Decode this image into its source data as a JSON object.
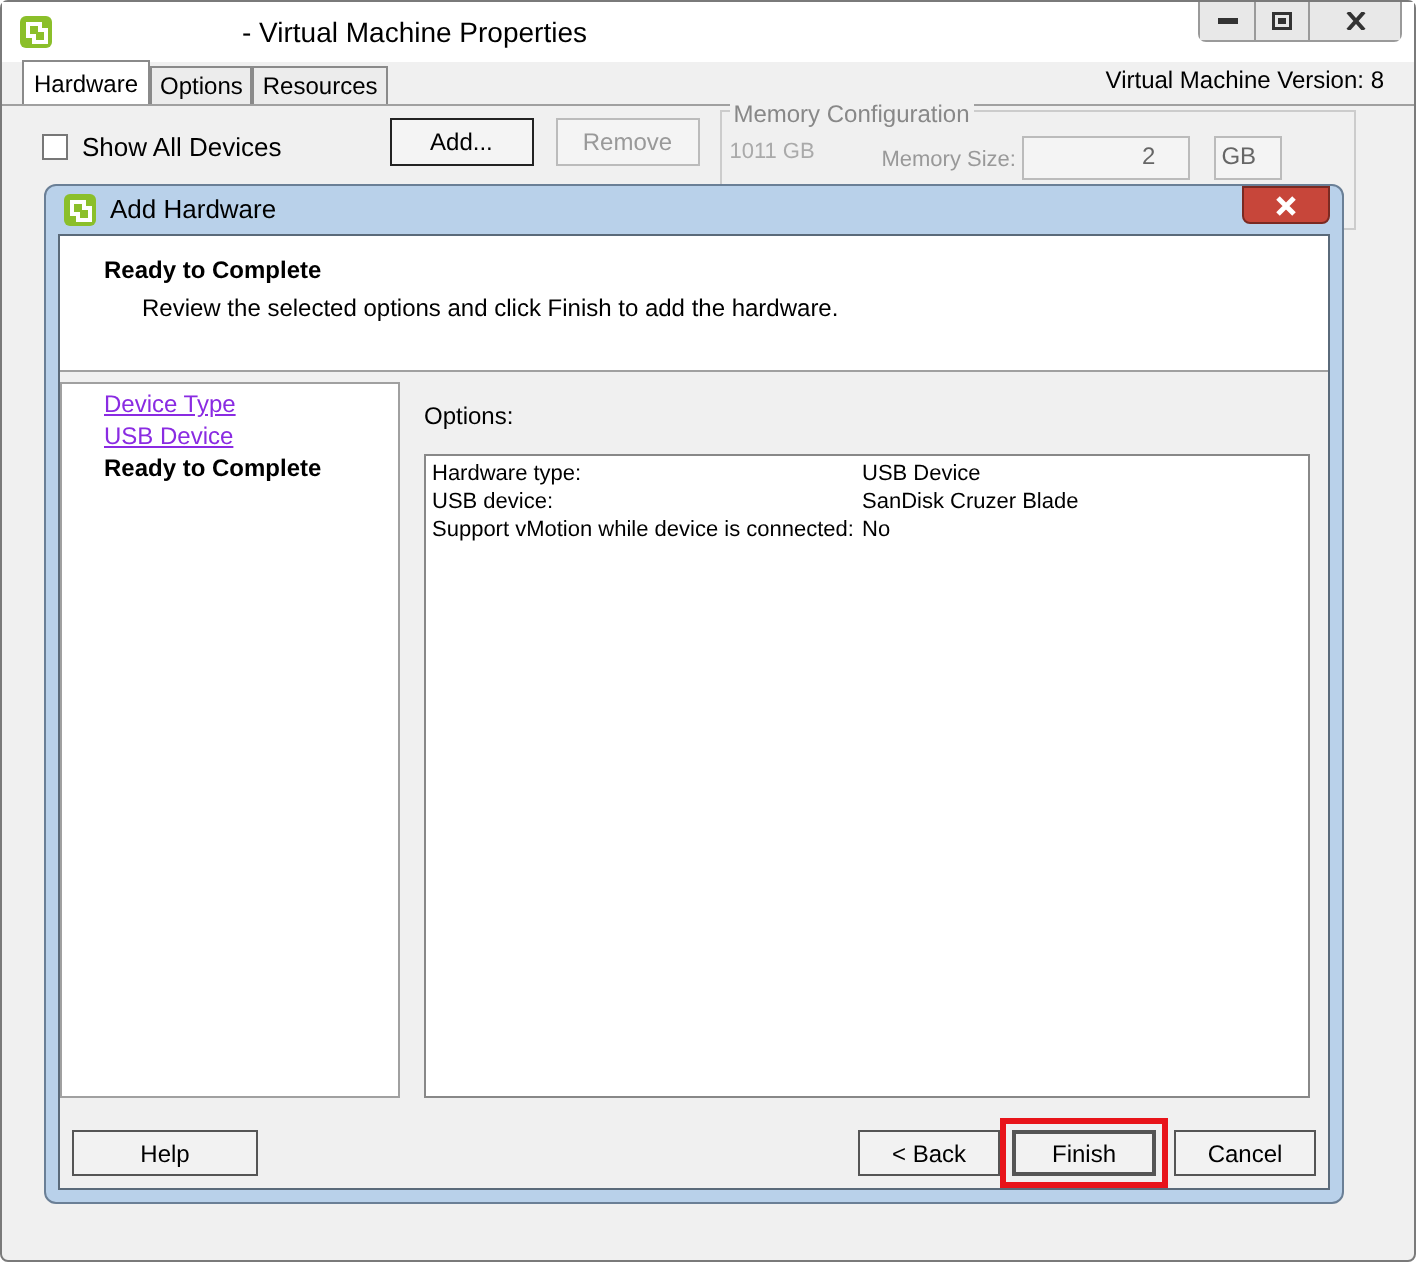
{
  "window": {
    "title": "- Virtual Machine Properties"
  },
  "tabs": [
    {
      "label": "Hardware",
      "selected": true
    },
    {
      "label": "Options",
      "selected": false
    },
    {
      "label": "Resources",
      "selected": false
    }
  ],
  "version": "Virtual Machine Version: 8",
  "show_all_devices": {
    "label": "Show All Devices",
    "checked": false
  },
  "buttons": [
    {
      "label": "Add...",
      "disabled": false
    },
    {
      "label": "Remove",
      "disabled": true
    }
  ],
  "memory": {
    "title": "Memory Configuration",
    "max": "1011 GB",
    "size_label": "Memory Size:",
    "size_value": "2",
    "unit": "GB"
  },
  "dialog": {
    "title": "Add Hardware",
    "heading": "Ready to Complete",
    "description": "Review the selected options and click Finish to add the hardware.",
    "steps": [
      {
        "label": "Device Type",
        "selected": false
      },
      {
        "label": "USB Device",
        "selected": false
      },
      {
        "label": "Ready to Complete",
        "selected": true
      }
    ],
    "options_label": "Options:",
    "options": [
      {
        "name": "Hardware type:",
        "value": "USB Device"
      },
      {
        "name": "USB device:",
        "value": "SanDisk Cruzer Blade"
      },
      {
        "name": "Support vMotion while device is connected:",
        "value": "No"
      }
    ],
    "buttons": [
      {
        "label": "Help",
        "highlighted": false
      },
      {
        "label": "< Back",
        "highlighted": false
      },
      {
        "label": "Finish",
        "highlighted": true
      },
      {
        "label": "Cancel",
        "highlighted": false
      }
    ]
  }
}
